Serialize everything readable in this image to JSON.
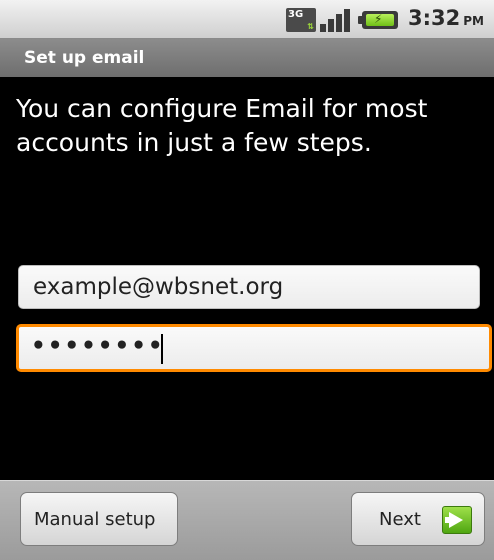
{
  "status_bar": {
    "network_label": "3G",
    "time": "3:32",
    "ampm": "PM",
    "icons": [
      "3g-data-icon",
      "signal-strength-icon",
      "battery-charging-icon"
    ]
  },
  "title_bar": {
    "title": "Set up email"
  },
  "intro": {
    "text": "You can configure Email for most accounts in just a few steps."
  },
  "form": {
    "email_value": "example@wbsnet.org",
    "password_value": "••••••••"
  },
  "buttons": {
    "manual_setup": "Manual setup",
    "next": "Next"
  },
  "colors": {
    "focus_border": "#ff8a00",
    "next_icon": "#6fbf17"
  }
}
